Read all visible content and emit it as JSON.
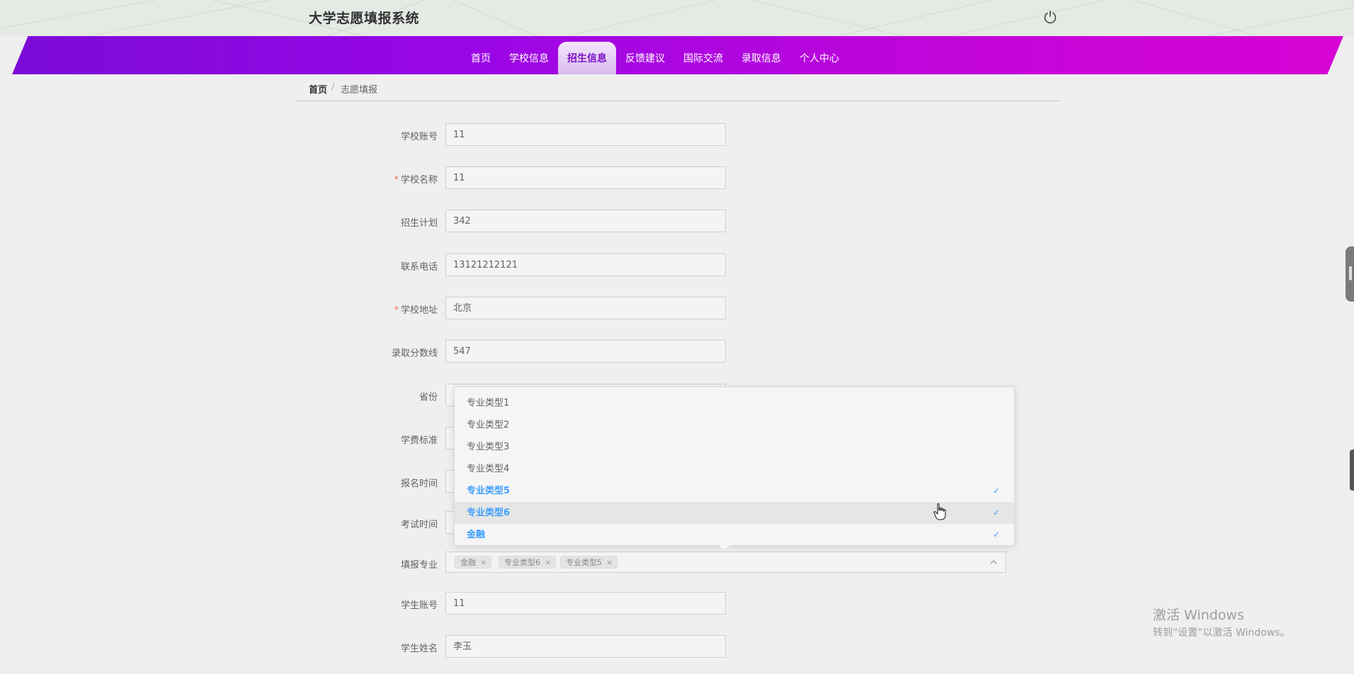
{
  "header": {
    "site_title": "大学志愿填报系统",
    "power_icon": "power-icon"
  },
  "nav": {
    "items": [
      {
        "label": "首页",
        "active": false
      },
      {
        "label": "学校信息",
        "active": false
      },
      {
        "label": "招生信息",
        "active": true
      },
      {
        "label": "反馈建议",
        "active": false
      },
      {
        "label": "国际交流",
        "active": false
      },
      {
        "label": "录取信息",
        "active": false
      },
      {
        "label": "个人中心",
        "active": false
      }
    ],
    "gradient_colors": [
      "#7b0bd8",
      "#d604d4"
    ]
  },
  "breadcrumb": {
    "home": "首页",
    "separator": "/",
    "current": "志愿填报"
  },
  "form": {
    "fields": [
      {
        "label": "学校账号",
        "required": false,
        "value": "11"
      },
      {
        "label": "学校名称",
        "required": true,
        "value": "11"
      },
      {
        "label": "招生计划",
        "required": false,
        "value": "342"
      },
      {
        "label": "联系电话",
        "required": false,
        "value": "13121212121"
      },
      {
        "label": "学校地址",
        "required": true,
        "value": "北京"
      },
      {
        "label": "录取分数线",
        "required": false,
        "value": "547"
      },
      {
        "label": "省份",
        "required": false,
        "value": ""
      },
      {
        "label": "学费标准",
        "required": false,
        "value": ""
      },
      {
        "label": "报名时间",
        "required": false,
        "value": ""
      },
      {
        "label": "考试时间",
        "required": false,
        "value": ""
      }
    ],
    "major_select": {
      "label": "填报专业",
      "tags": [
        "金融",
        "专业类型6",
        "专业类型5"
      ],
      "tag_close": "×",
      "arrow_icon": "chevron-up-icon"
    },
    "after_fields": [
      {
        "label": "学生账号",
        "required": false,
        "value": "11"
      },
      {
        "label": "学生姓名",
        "required": false,
        "value": "李玉"
      }
    ],
    "required_mark": "*"
  },
  "dropdown": {
    "options": [
      {
        "label": "专业类型1",
        "selected": false
      },
      {
        "label": "专业类型2",
        "selected": false
      },
      {
        "label": "专业类型3",
        "selected": false
      },
      {
        "label": "专业类型4",
        "selected": false
      },
      {
        "label": "专业类型5",
        "selected": true
      },
      {
        "label": "专业类型6",
        "selected": true,
        "hover": true
      },
      {
        "label": "金融",
        "selected": true
      }
    ],
    "check_mark": "✓",
    "selected_color": "#409eff"
  },
  "watermark": {
    "title": "激活 Windows",
    "subtitle": "转到“设置”以激活 Windows。"
  }
}
